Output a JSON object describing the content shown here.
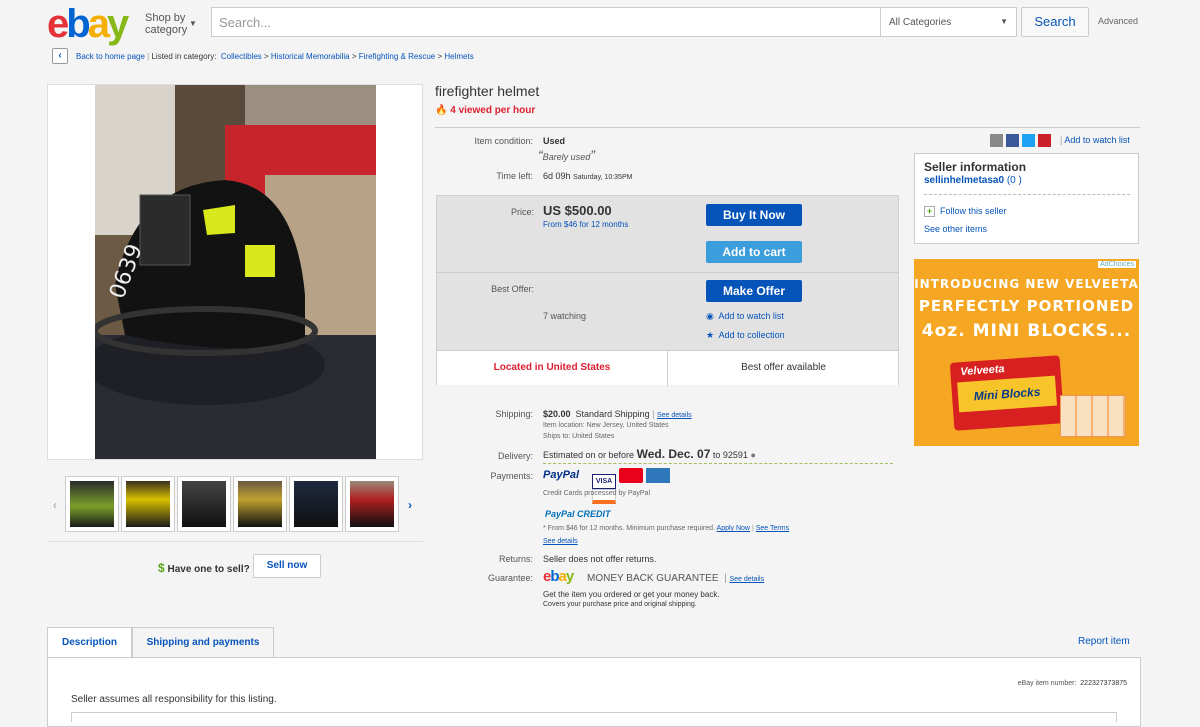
{
  "header": {
    "logo_letters": [
      "e",
      "b",
      "a",
      "y"
    ],
    "shop_by_line1": "Shop by",
    "shop_by_line2": "category",
    "search_placeholder": "Search...",
    "category_select": "All Categories",
    "search_button": "Search",
    "advanced": "Advanced"
  },
  "breadcrumb": {
    "back": "Back to home page",
    "listed": "Listed in category:",
    "items": [
      "Collectibles",
      "Historical Memorabilia",
      "Firefighting & Rescue",
      "Helmets"
    ],
    "separator": ">"
  },
  "item": {
    "title": "firefighter helmet",
    "viewed": "4 viewed per hour",
    "condition_label": "Item condition:",
    "condition": "Used",
    "condition_note": "Barely used",
    "time_left_label": "Time left:",
    "time_left": "6d 09h",
    "time_left_detail": "Saturday, 10:35PM",
    "price_label": "Price:",
    "price": "US $500.00",
    "financing": "From $46 for 12 months",
    "best_offer_label": "Best Offer:",
    "watching": "7 watching",
    "buy_now": "Buy It Now",
    "add_to_cart": "Add to cart",
    "make_offer": "Make Offer",
    "add_watch": "Add to watch list",
    "add_collection": "Add to collection",
    "located": "Located in United States",
    "best_offer_available": "Best offer available"
  },
  "shipping": {
    "label": "Shipping:",
    "cost": "$20.00",
    "method": "Standard Shipping",
    "see_details": "See details",
    "location": "Item location:  New Jersey, United States",
    "ships_to": "Ships to:  United States",
    "delivery_label": "Delivery:",
    "delivery_prefix": "Estimated on or before",
    "delivery_date": "Wed. Dec. 07",
    "delivery_to": "to 92591",
    "payments_label": "Payments:",
    "paypal": "PayPal",
    "cards_note": "Credit Cards processed by PayPal",
    "paypal_credit": "PayPal CREDIT",
    "credit_note": "* From $46 for 12 months. Minimum purchase required.",
    "apply_now": "Apply Now",
    "see_terms": "See Terms",
    "see_details2": "See details",
    "returns_label": "Returns:",
    "returns": "Seller does not offer returns.",
    "guarantee_label": "Guarantee:",
    "guarantee": "MONEY BACK GUARANTEE",
    "guarantee_details": "See details",
    "guarantee_line1": "Get the item you ordered or get your money back.",
    "guarantee_line2": "Covers your purchase price and original shipping."
  },
  "seller": {
    "heading": "Seller information",
    "name": "sellinhelmetasa0",
    "score": "(0 )",
    "follow": "Follow this seller",
    "other_items": "See other items"
  },
  "social": {
    "add_watch": "Add to watch list"
  },
  "ad": {
    "adchoices": "AdChoices",
    "line1": "INTRODUCING NEW VELVEETA",
    "line2": "PERFECTLY PORTIONED",
    "line3": "4oz. MINI BLOCKS...",
    "brand": "Velveeta",
    "product": "Mini Blocks"
  },
  "sell": {
    "have_one": "Have one to sell?",
    "sell_now": "Sell now"
  },
  "tabs": {
    "description": "Description",
    "shipping": "Shipping and payments",
    "report": "Report item",
    "item_number_label": "eBay item number:",
    "item_number": "222327373875",
    "responsibility": "Seller assumes all responsibility for this listing."
  },
  "colors": {
    "ebay_red": "#e53238",
    "ebay_blue": "#0064d2",
    "ebay_yellow": "#f5af02",
    "ebay_green": "#86b817",
    "link": "#0654ba",
    "alert_red": "#dd1e31"
  },
  "helmet_number": "0639"
}
